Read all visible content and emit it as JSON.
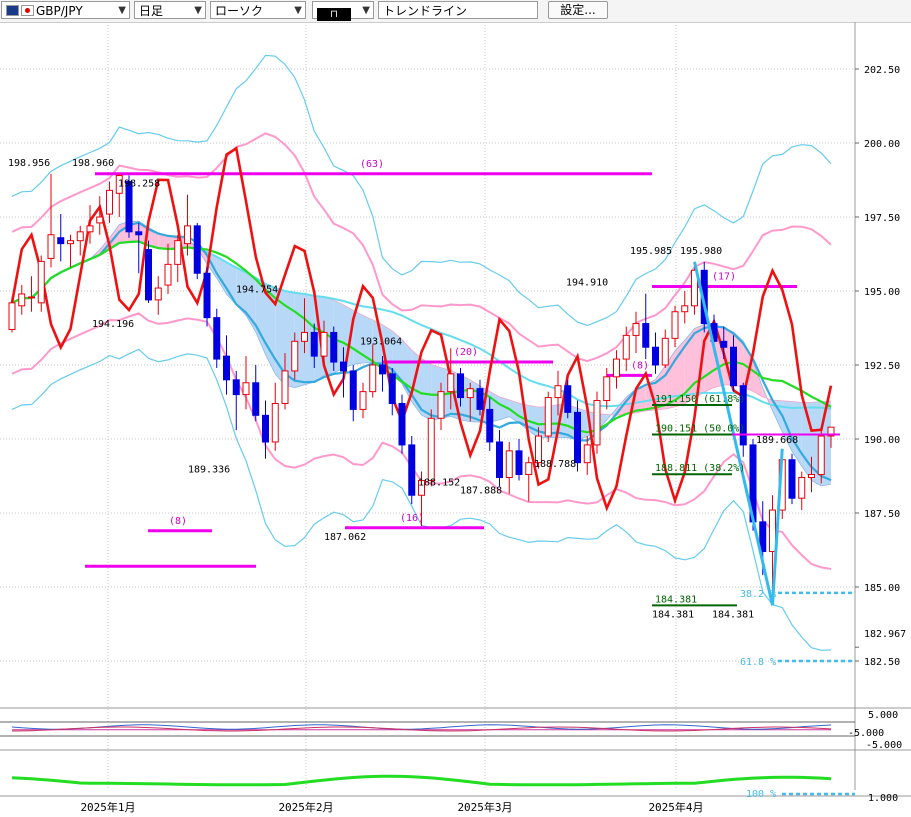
{
  "toolbar": {
    "pair": "GBP/JPY",
    "timeframe": "日足",
    "chart_style": "ローソク",
    "tool": "トレンドライン",
    "settings_label": "設定..."
  },
  "colors": {
    "bull": "#e8000a",
    "bear": "#0000e0",
    "bb_mid": "#22dd22",
    "bb_2": "#ff99cc",
    "bb_3": "#66ccee",
    "cloud_up": "#ffc0dc",
    "cloud_dn": "#b8d8f8",
    "pivot_line": "#ee00ee",
    "signal_line": "#ee1111",
    "fib_line": "#33bbee"
  },
  "chart_data": {
    "type": "candlestick",
    "x_tick_labels": [
      "2025年1月",
      "2025年2月",
      "2025年3月",
      "2025年4月"
    ],
    "y_tick_labels": [
      "202.50",
      "200.00",
      "197.50",
      "195.00",
      "192.50",
      "190.00",
      "187.50",
      "185.00",
      "182.967",
      "182.50"
    ],
    "ylim": [
      181.5,
      204.1
    ],
    "grid": true,
    "price_annotations": [
      {
        "text": "198.956",
        "price": 198.956
      },
      {
        "text": "198.960",
        "price": 198.96
      },
      {
        "text": "198.258",
        "price": 198.258
      },
      {
        "text": "194.196",
        "price": 194.196
      },
      {
        "text": "194.754",
        "price": 194.754
      },
      {
        "text": "189.336",
        "price": 189.336
      },
      {
        "text": "193.064",
        "price": 193.064
      },
      {
        "text": "187.062",
        "price": 187.062
      },
      {
        "text": "188.152",
        "price": 188.152
      },
      {
        "text": "187.888",
        "price": 187.888
      },
      {
        "text": "188.788",
        "price": 188.788
      },
      {
        "text": "194.910",
        "price": 194.91
      },
      {
        "text": "195.985",
        "price": 195.985
      },
      {
        "text": "195.980",
        "price": 195.98
      },
      {
        "text": "189.668",
        "price": 189.668
      },
      {
        "text": "184.381",
        "price": 184.381
      },
      {
        "text": "184.381",
        "price": 184.381
      }
    ],
    "period_labels": [
      "(63)",
      "(8)",
      "(20)",
      "(16)",
      "(8)",
      "(17)"
    ],
    "fibonacci": [
      {
        "text": "191.150 (61.8%)",
        "price": 191.15
      },
      {
        "text": "190.151 (50.0%)",
        "price": 190.151
      },
      {
        "text": "188.811 (38.2%)",
        "price": 188.811
      },
      {
        "text": "184.381",
        "price": 184.381
      }
    ],
    "lower_panel_labels": [
      "38.2 %",
      "61.8 %",
      "100 %"
    ],
    "oscillator_ticks": [
      "5.000",
      "-5.000",
      "-5.000",
      "1.000"
    ],
    "candles": [
      [
        193.7,
        194.8,
        193.6,
        194.6
      ],
      [
        194.5,
        195.2,
        194.2,
        194.9
      ],
      [
        194.8,
        195.5,
        194.3,
        194.8
      ],
      [
        194.6,
        196.2,
        194.3,
        196.0
      ],
      [
        196.1,
        198.956,
        195.8,
        196.9
      ],
      [
        196.8,
        197.6,
        196.0,
        196.6
      ],
      [
        196.6,
        196.9,
        195.8,
        196.7
      ],
      [
        196.7,
        197.2,
        196.2,
        197.0
      ],
      [
        197.0,
        197.9,
        196.6,
        197.2
      ],
      [
        197.3,
        198.2,
        196.9,
        197.5
      ],
      [
        197.6,
        198.7,
        197.3,
        198.4
      ],
      [
        198.3,
        198.96,
        197.5,
        198.9
      ],
      [
        198.7,
        198.9,
        196.8,
        197.0
      ],
      [
        197.0,
        197.3,
        195.6,
        196.9
      ],
      [
        196.4,
        196.7,
        194.6,
        194.7
      ],
      [
        194.7,
        195.5,
        194.196,
        195.1
      ],
      [
        195.2,
        196.6,
        194.9,
        195.9
      ],
      [
        195.9,
        196.9,
        195.3,
        196.7
      ],
      [
        196.6,
        198.258,
        196.2,
        197.2
      ],
      [
        197.2,
        197.3,
        195.4,
        195.6
      ],
      [
        195.6,
        195.8,
        193.8,
        194.1
      ],
      [
        194.1,
        194.4,
        192.4,
        192.7
      ],
      [
        192.8,
        193.5,
        191.5,
        192.0
      ],
      [
        192.0,
        192.3,
        190.3,
        191.5
      ],
      [
        191.5,
        192.8,
        191.0,
        191.9
      ],
      [
        191.9,
        192.5,
        190.6,
        190.8
      ],
      [
        190.8,
        191.3,
        189.336,
        189.9
      ],
      [
        189.9,
        191.9,
        189.6,
        191.2
      ],
      [
        191.2,
        192.9,
        191.0,
        192.3
      ],
      [
        192.3,
        193.6,
        192.0,
        193.3
      ],
      [
        193.3,
        194.754,
        192.9,
        193.6
      ],
      [
        193.6,
        193.9,
        192.4,
        192.8
      ],
      [
        192.8,
        194.0,
        192.6,
        193.6
      ],
      [
        193.6,
        193.8,
        192.3,
        192.6
      ],
      [
        192.6,
        193.1,
        191.4,
        192.3
      ],
      [
        192.3,
        192.5,
        190.6,
        191.0
      ],
      [
        191.0,
        191.9,
        190.7,
        191.6
      ],
      [
        191.6,
        193.2,
        191.4,
        192.5
      ],
      [
        192.5,
        192.8,
        191.6,
        192.2
      ],
      [
        192.2,
        192.4,
        190.8,
        191.2
      ],
      [
        191.2,
        191.5,
        189.5,
        189.8
      ],
      [
        189.8,
        190.1,
        187.8,
        188.1
      ],
      [
        188.1,
        188.9,
        187.062,
        188.6
      ],
      [
        188.6,
        191.0,
        188.4,
        190.7
      ],
      [
        190.7,
        191.9,
        190.3,
        191.6
      ],
      [
        191.6,
        193.064,
        191.0,
        192.2
      ],
      [
        192.2,
        192.4,
        191.1,
        191.4
      ],
      [
        191.4,
        191.9,
        190.6,
        191.7
      ],
      [
        191.7,
        192.0,
        190.8,
        191.0
      ],
      [
        191.0,
        191.4,
        189.6,
        189.9
      ],
      [
        189.9,
        190.3,
        188.4,
        188.7
      ],
      [
        188.7,
        189.9,
        188.152,
        189.6
      ],
      [
        189.6,
        190.0,
        188.6,
        188.8
      ],
      [
        188.8,
        189.4,
        187.888,
        189.2
      ],
      [
        189.2,
        190.4,
        189.0,
        190.1
      ],
      [
        190.1,
        191.6,
        189.9,
        191.4
      ],
      [
        191.4,
        192.3,
        190.8,
        191.8
      ],
      [
        191.8,
        192.0,
        190.7,
        190.9
      ],
      [
        190.9,
        191.3,
        188.9,
        189.2
      ],
      [
        189.2,
        190.1,
        188.788,
        189.8
      ],
      [
        189.8,
        191.6,
        189.5,
        191.3
      ],
      [
        191.3,
        192.4,
        191.0,
        192.1
      ],
      [
        192.1,
        193.0,
        191.7,
        192.7
      ],
      [
        192.7,
        193.8,
        192.3,
        193.5
      ],
      [
        193.5,
        194.3,
        192.9,
        193.9
      ],
      [
        193.9,
        194.91,
        192.7,
        193.1
      ],
      [
        193.1,
        193.6,
        192.2,
        192.5
      ],
      [
        192.5,
        193.7,
        192.4,
        193.4
      ],
      [
        193.4,
        194.5,
        193.1,
        194.3
      ],
      [
        194.3,
        195.0,
        193.9,
        194.5
      ],
      [
        194.5,
        195.985,
        194.2,
        195.7
      ],
      [
        195.7,
        195.98,
        193.6,
        193.9
      ],
      [
        193.9,
        194.2,
        192.9,
        193.3
      ],
      [
        193.3,
        193.8,
        192.7,
        193.1
      ],
      [
        193.1,
        193.5,
        191.6,
        191.8
      ],
      [
        191.8,
        191.9,
        189.4,
        189.8
      ],
      [
        189.8,
        190.0,
        186.9,
        187.2
      ],
      [
        187.2,
        187.9,
        185.4,
        186.2
      ],
      [
        186.2,
        188.1,
        184.381,
        187.6
      ],
      [
        187.6,
        189.668,
        187.3,
        189.3
      ],
      [
        189.3,
        189.5,
        187.8,
        188.0
      ],
      [
        188.0,
        188.9,
        187.6,
        188.7
      ],
      [
        188.7,
        189.4,
        188.2,
        188.8
      ],
      [
        188.8,
        190.3,
        188.5,
        190.1
      ],
      [
        190.1,
        190.4,
        189.7,
        190.4
      ]
    ]
  }
}
